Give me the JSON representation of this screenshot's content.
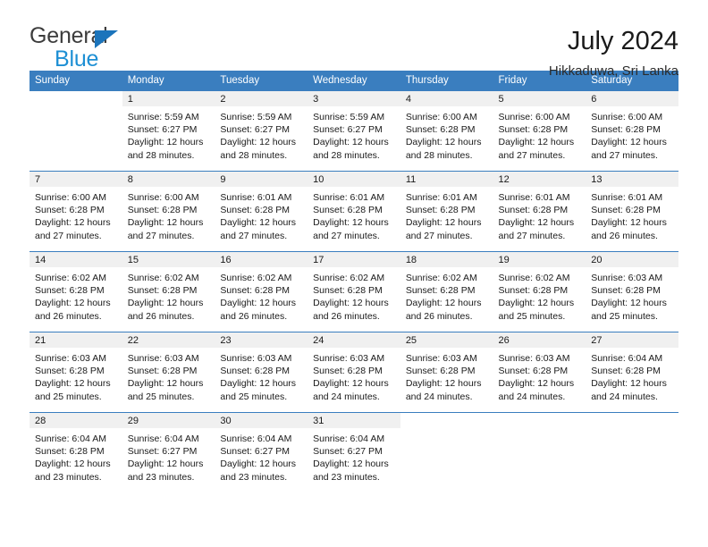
{
  "brand": {
    "name_part1": "General",
    "name_part2": "Blue",
    "triangle_icon": "blue-triangle-icon",
    "accent_color": "#1b74bb"
  },
  "header": {
    "title": "July 2024",
    "subtitle": "Hikkaduwa, Sri Lanka"
  },
  "theme": {
    "header_blue": "#3a7ebf",
    "daynum_band": "#f0f0f0",
    "text": "#1a1a1a"
  },
  "weekday_headers": [
    "Sunday",
    "Monday",
    "Tuesday",
    "Wednesday",
    "Thursday",
    "Friday",
    "Saturday"
  ],
  "labels": {
    "sunrise_prefix": "Sunrise:",
    "sunset_prefix": "Sunset:",
    "daylight_prefix": "Daylight:"
  },
  "weeks": [
    [
      {
        "day": "",
        "sunrise": "",
        "sunset": "",
        "daylight_line1": "",
        "daylight_line2": ""
      },
      {
        "day": "1",
        "sunrise": "Sunrise: 5:59 AM",
        "sunset": "Sunset: 6:27 PM",
        "daylight_line1": "Daylight: 12 hours",
        "daylight_line2": "and 28 minutes."
      },
      {
        "day": "2",
        "sunrise": "Sunrise: 5:59 AM",
        "sunset": "Sunset: 6:27 PM",
        "daylight_line1": "Daylight: 12 hours",
        "daylight_line2": "and 28 minutes."
      },
      {
        "day": "3",
        "sunrise": "Sunrise: 5:59 AM",
        "sunset": "Sunset: 6:27 PM",
        "daylight_line1": "Daylight: 12 hours",
        "daylight_line2": "and 28 minutes."
      },
      {
        "day": "4",
        "sunrise": "Sunrise: 6:00 AM",
        "sunset": "Sunset: 6:28 PM",
        "daylight_line1": "Daylight: 12 hours",
        "daylight_line2": "and 28 minutes."
      },
      {
        "day": "5",
        "sunrise": "Sunrise: 6:00 AM",
        "sunset": "Sunset: 6:28 PM",
        "daylight_line1": "Daylight: 12 hours",
        "daylight_line2": "and 27 minutes."
      },
      {
        "day": "6",
        "sunrise": "Sunrise: 6:00 AM",
        "sunset": "Sunset: 6:28 PM",
        "daylight_line1": "Daylight: 12 hours",
        "daylight_line2": "and 27 minutes."
      }
    ],
    [
      {
        "day": "7",
        "sunrise": "Sunrise: 6:00 AM",
        "sunset": "Sunset: 6:28 PM",
        "daylight_line1": "Daylight: 12 hours",
        "daylight_line2": "and 27 minutes."
      },
      {
        "day": "8",
        "sunrise": "Sunrise: 6:00 AM",
        "sunset": "Sunset: 6:28 PM",
        "daylight_line1": "Daylight: 12 hours",
        "daylight_line2": "and 27 minutes."
      },
      {
        "day": "9",
        "sunrise": "Sunrise: 6:01 AM",
        "sunset": "Sunset: 6:28 PM",
        "daylight_line1": "Daylight: 12 hours",
        "daylight_line2": "and 27 minutes."
      },
      {
        "day": "10",
        "sunrise": "Sunrise: 6:01 AM",
        "sunset": "Sunset: 6:28 PM",
        "daylight_line1": "Daylight: 12 hours",
        "daylight_line2": "and 27 minutes."
      },
      {
        "day": "11",
        "sunrise": "Sunrise: 6:01 AM",
        "sunset": "Sunset: 6:28 PM",
        "daylight_line1": "Daylight: 12 hours",
        "daylight_line2": "and 27 minutes."
      },
      {
        "day": "12",
        "sunrise": "Sunrise: 6:01 AM",
        "sunset": "Sunset: 6:28 PM",
        "daylight_line1": "Daylight: 12 hours",
        "daylight_line2": "and 27 minutes."
      },
      {
        "day": "13",
        "sunrise": "Sunrise: 6:01 AM",
        "sunset": "Sunset: 6:28 PM",
        "daylight_line1": "Daylight: 12 hours",
        "daylight_line2": "and 26 minutes."
      }
    ],
    [
      {
        "day": "14",
        "sunrise": "Sunrise: 6:02 AM",
        "sunset": "Sunset: 6:28 PM",
        "daylight_line1": "Daylight: 12 hours",
        "daylight_line2": "and 26 minutes."
      },
      {
        "day": "15",
        "sunrise": "Sunrise: 6:02 AM",
        "sunset": "Sunset: 6:28 PM",
        "daylight_line1": "Daylight: 12 hours",
        "daylight_line2": "and 26 minutes."
      },
      {
        "day": "16",
        "sunrise": "Sunrise: 6:02 AM",
        "sunset": "Sunset: 6:28 PM",
        "daylight_line1": "Daylight: 12 hours",
        "daylight_line2": "and 26 minutes."
      },
      {
        "day": "17",
        "sunrise": "Sunrise: 6:02 AM",
        "sunset": "Sunset: 6:28 PM",
        "daylight_line1": "Daylight: 12 hours",
        "daylight_line2": "and 26 minutes."
      },
      {
        "day": "18",
        "sunrise": "Sunrise: 6:02 AM",
        "sunset": "Sunset: 6:28 PM",
        "daylight_line1": "Daylight: 12 hours",
        "daylight_line2": "and 26 minutes."
      },
      {
        "day": "19",
        "sunrise": "Sunrise: 6:02 AM",
        "sunset": "Sunset: 6:28 PM",
        "daylight_line1": "Daylight: 12 hours",
        "daylight_line2": "and 25 minutes."
      },
      {
        "day": "20",
        "sunrise": "Sunrise: 6:03 AM",
        "sunset": "Sunset: 6:28 PM",
        "daylight_line1": "Daylight: 12 hours",
        "daylight_line2": "and 25 minutes."
      }
    ],
    [
      {
        "day": "21",
        "sunrise": "Sunrise: 6:03 AM",
        "sunset": "Sunset: 6:28 PM",
        "daylight_line1": "Daylight: 12 hours",
        "daylight_line2": "and 25 minutes."
      },
      {
        "day": "22",
        "sunrise": "Sunrise: 6:03 AM",
        "sunset": "Sunset: 6:28 PM",
        "daylight_line1": "Daylight: 12 hours",
        "daylight_line2": "and 25 minutes."
      },
      {
        "day": "23",
        "sunrise": "Sunrise: 6:03 AM",
        "sunset": "Sunset: 6:28 PM",
        "daylight_line1": "Daylight: 12 hours",
        "daylight_line2": "and 25 minutes."
      },
      {
        "day": "24",
        "sunrise": "Sunrise: 6:03 AM",
        "sunset": "Sunset: 6:28 PM",
        "daylight_line1": "Daylight: 12 hours",
        "daylight_line2": "and 24 minutes."
      },
      {
        "day": "25",
        "sunrise": "Sunrise: 6:03 AM",
        "sunset": "Sunset: 6:28 PM",
        "daylight_line1": "Daylight: 12 hours",
        "daylight_line2": "and 24 minutes."
      },
      {
        "day": "26",
        "sunrise": "Sunrise: 6:03 AM",
        "sunset": "Sunset: 6:28 PM",
        "daylight_line1": "Daylight: 12 hours",
        "daylight_line2": "and 24 minutes."
      },
      {
        "day": "27",
        "sunrise": "Sunrise: 6:04 AM",
        "sunset": "Sunset: 6:28 PM",
        "daylight_line1": "Daylight: 12 hours",
        "daylight_line2": "and 24 minutes."
      }
    ],
    [
      {
        "day": "28",
        "sunrise": "Sunrise: 6:04 AM",
        "sunset": "Sunset: 6:28 PM",
        "daylight_line1": "Daylight: 12 hours",
        "daylight_line2": "and 23 minutes."
      },
      {
        "day": "29",
        "sunrise": "Sunrise: 6:04 AM",
        "sunset": "Sunset: 6:27 PM",
        "daylight_line1": "Daylight: 12 hours",
        "daylight_line2": "and 23 minutes."
      },
      {
        "day": "30",
        "sunrise": "Sunrise: 6:04 AM",
        "sunset": "Sunset: 6:27 PM",
        "daylight_line1": "Daylight: 12 hours",
        "daylight_line2": "and 23 minutes."
      },
      {
        "day": "31",
        "sunrise": "Sunrise: 6:04 AM",
        "sunset": "Sunset: 6:27 PM",
        "daylight_line1": "Daylight: 12 hours",
        "daylight_line2": "and 23 minutes."
      },
      {
        "day": "",
        "sunrise": "",
        "sunset": "",
        "daylight_line1": "",
        "daylight_line2": ""
      },
      {
        "day": "",
        "sunrise": "",
        "sunset": "",
        "daylight_line1": "",
        "daylight_line2": ""
      },
      {
        "day": "",
        "sunrise": "",
        "sunset": "",
        "daylight_line1": "",
        "daylight_line2": ""
      }
    ]
  ]
}
